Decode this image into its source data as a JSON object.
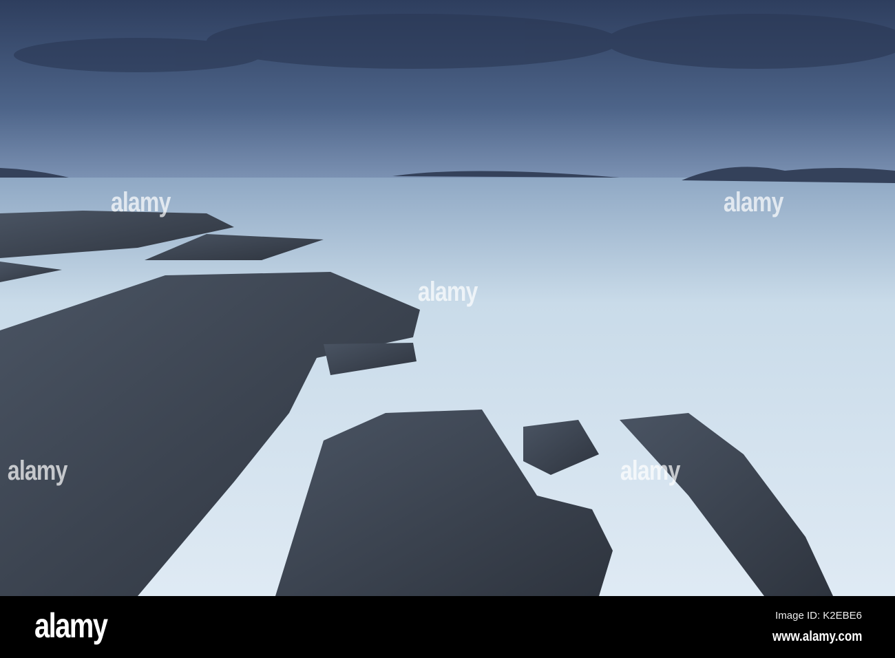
{
  "photo": {
    "subject": "Long exposure of waves over coastal rocks at dusk",
    "colors": {
      "sky": "#3f5478",
      "sea": "#cfe0ee",
      "rock": "#3b4350"
    }
  },
  "watermark": {
    "text": "alamy"
  },
  "footer": {
    "logo": "alamy",
    "image_id": "Image ID: K2EBE6",
    "url": "www.alamy.com"
  }
}
